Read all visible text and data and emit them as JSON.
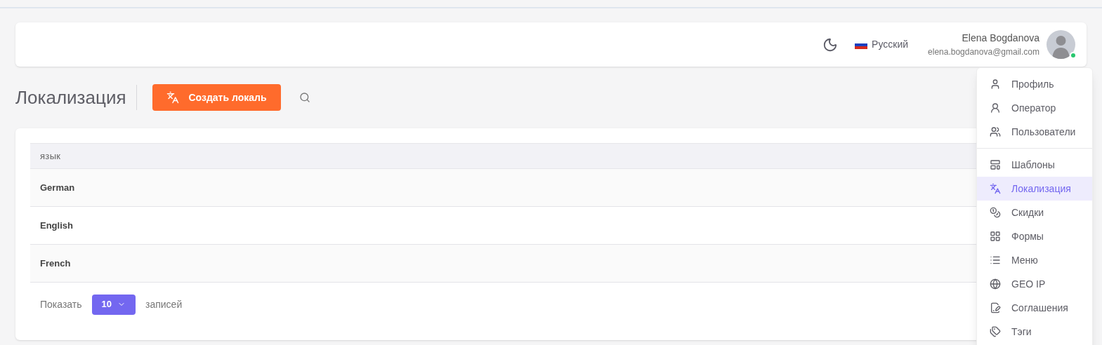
{
  "header": {
    "language": "Русский",
    "user": {
      "name": "Elena Bogdanova",
      "email": "elena.bogdanova@gmail.com",
      "online": true
    }
  },
  "page": {
    "title": "Локализация",
    "create_button": "Создать локаль"
  },
  "table": {
    "columns": [
      "язык"
    ],
    "rows": [
      "German",
      "English",
      "French"
    ]
  },
  "pagination": {
    "show_label": "Показать",
    "page_size": "10",
    "entries_label": "записей"
  },
  "user_menu": {
    "groups": [
      [
        {
          "label": "Профиль",
          "selected": false
        },
        {
          "label": "Оператор",
          "selected": false
        },
        {
          "label": "Пользователи",
          "selected": false
        }
      ],
      [
        {
          "label": "Шаблоны",
          "selected": false
        },
        {
          "label": "Локализация",
          "selected": true
        },
        {
          "label": "Скидки",
          "selected": false
        },
        {
          "label": "Формы",
          "selected": false
        },
        {
          "label": "Меню",
          "selected": false
        },
        {
          "label": "GEO IP",
          "selected": false
        },
        {
          "label": "Соглашения",
          "selected": false
        },
        {
          "label": "Тэги",
          "selected": false
        }
      ]
    ]
  }
}
